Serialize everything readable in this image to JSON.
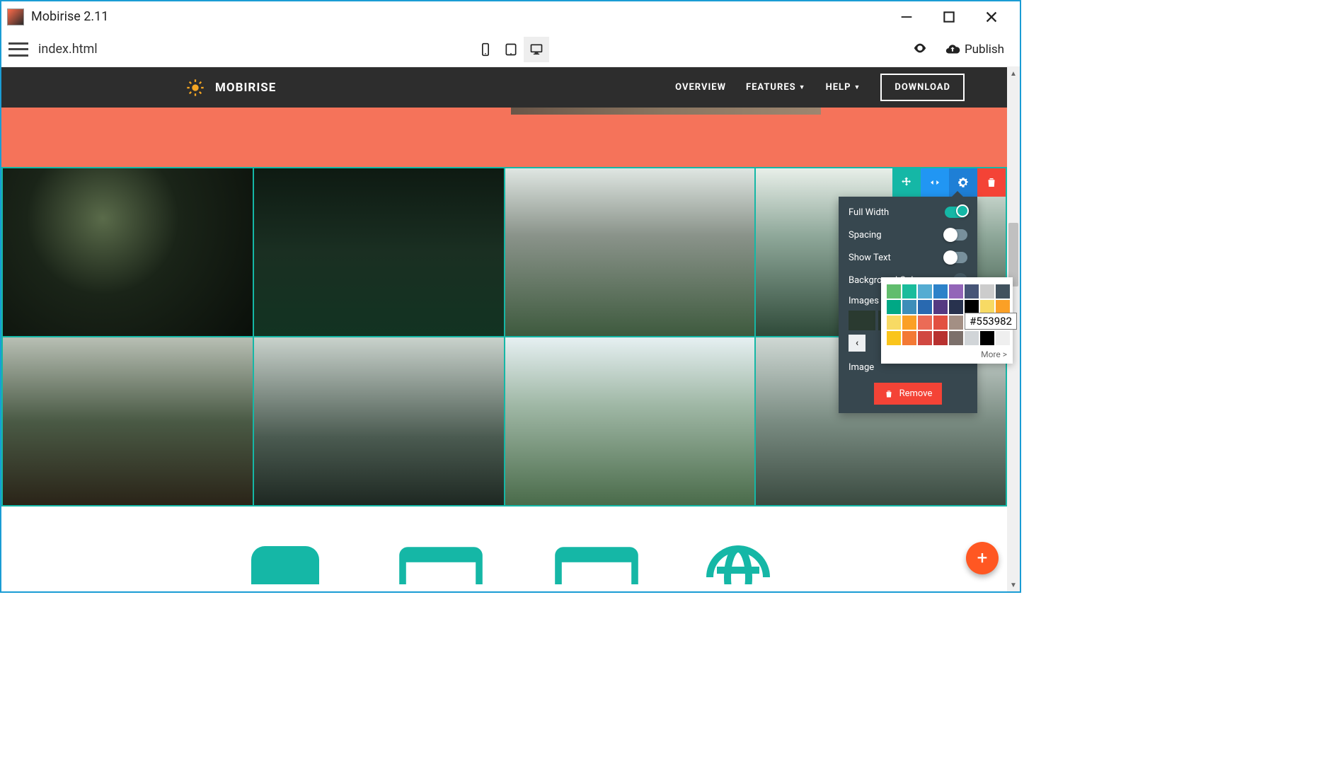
{
  "titlebar": {
    "title": "Mobirise 2.11"
  },
  "toolbar": {
    "filename": "index.html",
    "publish_label": "Publish"
  },
  "site_header": {
    "brand": "MOBIRISE",
    "nav": {
      "overview": "OVERVIEW",
      "features": "FEATURES",
      "help": "HELP",
      "download": "DOWNLOAD"
    }
  },
  "block_actions": {
    "move": "move-icon",
    "code": "code-icon",
    "settings": "gear-icon",
    "delete": "trash-icon"
  },
  "settings_panel": {
    "full_width": {
      "label": "Full Width",
      "on": true
    },
    "spacing": {
      "label": "Spacing",
      "on": false
    },
    "show_text": {
      "label": "Show Text",
      "on": false
    },
    "bg_color": {
      "label": "Background Color"
    },
    "images": {
      "label": "Images"
    },
    "image": {
      "label": "Image"
    },
    "remove": "Remove"
  },
  "picker": {
    "more": "More >",
    "hover_hex": "#553982",
    "swatches": [
      "#61BD6D",
      "#1ABC9C",
      "#54ACD2",
      "#2C82C9",
      "#9365B8",
      "#475577",
      "#CCCCCC",
      "#41525E",
      "#00A885",
      "#3D8EB9",
      "#2969B0",
      "#553982",
      "#28324E",
      "#000000",
      "#F7DA64",
      "#FBA026",
      "#F7DA64",
      "#FBA026",
      "#EB6B56",
      "#E25041",
      "#A38F84",
      "#EFEFEF",
      "#FAC51C",
      "#F37934",
      "#FAC51C",
      "#F37934",
      "#D14841",
      "#B8312F",
      "#7C706B",
      "#D1D5D8",
      "#000000",
      "#EFEFEF"
    ]
  },
  "gallery": {
    "rows": 2,
    "cols": 4
  },
  "fab": {
    "label": "+"
  }
}
